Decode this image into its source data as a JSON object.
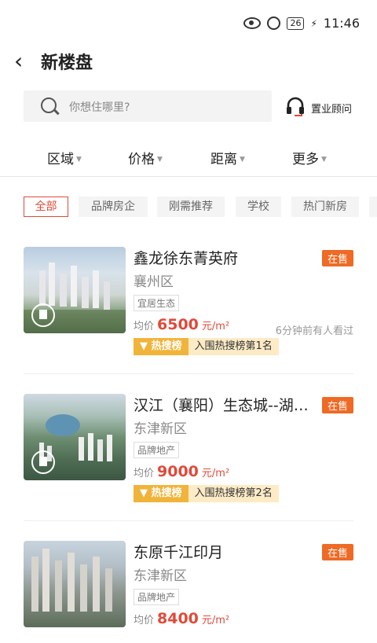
{
  "status": {
    "time": "11:46",
    "battery": "26"
  },
  "header": {
    "title": "新楼盘"
  },
  "search": {
    "placeholder": "你想住哪里?",
    "consult": "置业顾问"
  },
  "filters": [
    "区域",
    "价格",
    "距离",
    "更多"
  ],
  "tags": [
    "全部",
    "品牌房企",
    "刚需推荐",
    "学校",
    "热门新房"
  ],
  "listings": [
    {
      "name": "鑫龙徐东菁英府",
      "badge": "在售",
      "district": "襄州区",
      "tag": "宜居生态",
      "price_label": "均价",
      "price": "6500",
      "unit": "元/m²",
      "viewers": "6分钟前有人看过",
      "hot_label": "热搜榜",
      "hot_rank": "入围热搜榜第1名"
    },
    {
      "name": "汉江（襄阳）生态城--湖…",
      "badge": "在售",
      "district": "东津新区",
      "tag": "品牌地产",
      "price_label": "均价",
      "price": "9000",
      "unit": "元/m²",
      "viewers": "",
      "hot_label": "热搜榜",
      "hot_rank": "入围热搜榜第2名"
    },
    {
      "name": "东原千江印月",
      "badge": "在售",
      "district": "东津新区",
      "tag": "品牌地产",
      "price_label": "均价",
      "price": "8400",
      "unit": "元/m²",
      "viewers": "",
      "hot_label": "",
      "hot_rank": ""
    }
  ]
}
